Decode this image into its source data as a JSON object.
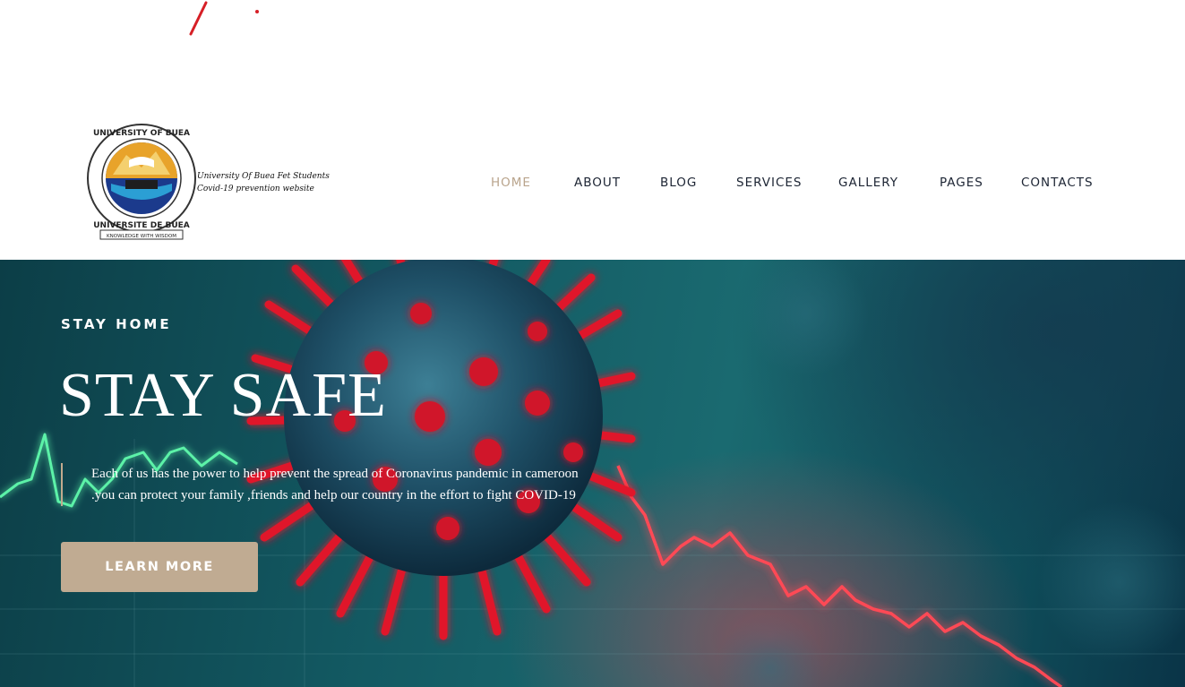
{
  "logo": {
    "line1": "University Of Buea Fet Students",
    "line2": "Covid-19 prevention website",
    "seal_top": "UNIVERSITY OF BUEA",
    "seal_bottom": "UNIVERSITE DE BUEA",
    "seal_motto": "KNOWLEDGE WITH WISDOM"
  },
  "nav": {
    "items": [
      {
        "label": "HOME",
        "active": true
      },
      {
        "label": "ABOUT"
      },
      {
        "label": "BLOG"
      },
      {
        "label": "SERVICES"
      },
      {
        "label": "GALLERY"
      },
      {
        "label": "PAGES"
      },
      {
        "label": "CONTACTS"
      }
    ]
  },
  "hero": {
    "eyebrow": "STAY HOME",
    "title": "STAY SAFE",
    "text_line1": "Each of us has the power to help prevent the spread of Coronavirus pandemic in cameroon",
    "text_line2": ".you can protect your family ,friends and help our country in the effort to fight COVID-19",
    "button": "LEARN MORE"
  },
  "colors": {
    "accent": "#c0ab92",
    "nav_active": "#b9a48c",
    "nav_text": "#1c2433",
    "hero_teal": "#135a63",
    "virus_red": "#e0192b"
  },
  "icons": [
    "university-seal-logo",
    "coronavirus-illustration",
    "chart-line-decoration"
  ]
}
